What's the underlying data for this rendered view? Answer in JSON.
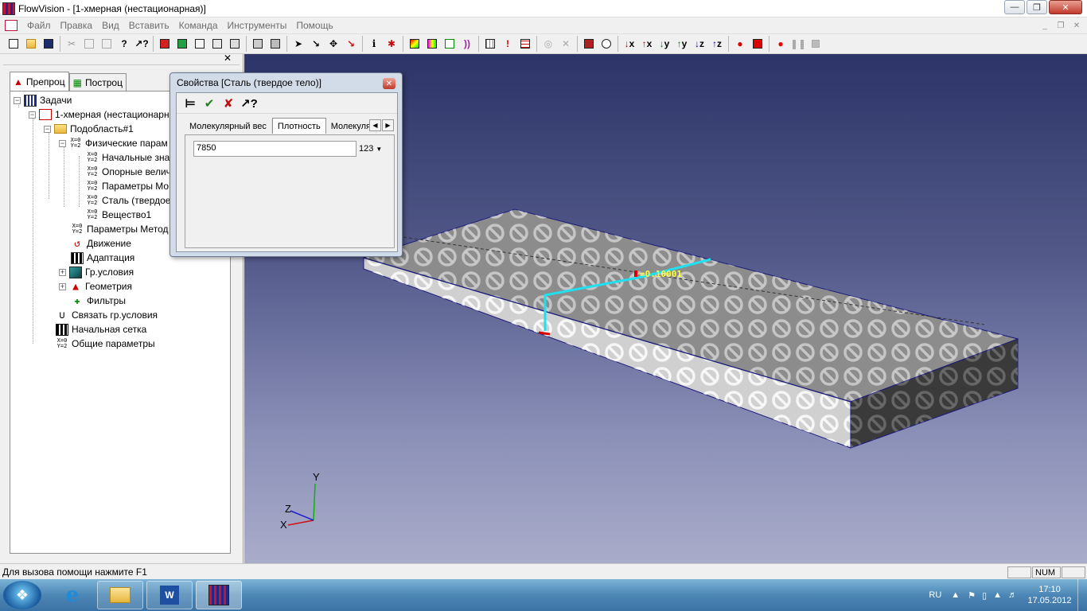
{
  "window": {
    "title": "FlowVision - [1-хмерная (нестационарная)]"
  },
  "menu": [
    "Файл",
    "Правка",
    "Вид",
    "Вставить",
    "Команда",
    "Инструменты",
    "Помощь"
  ],
  "left_panel": {
    "tabs": [
      "Препроц",
      "Построц"
    ],
    "tree": [
      {
        "label": "Задачи"
      },
      {
        "label": "1-хмерная (нестационарн"
      },
      {
        "label": "Подобласть#1"
      },
      {
        "label": "Физические парам"
      },
      {
        "label": "Начальные зна"
      },
      {
        "label": "Опорные велич"
      },
      {
        "label": "Параметры Мо"
      },
      {
        "label": "Сталь (твердое"
      },
      {
        "label": "Вещество1"
      },
      {
        "label": "Параметры Метод"
      },
      {
        "label": "Движение"
      },
      {
        "label": "Адаптация"
      },
      {
        "label": "Гр.условия"
      },
      {
        "label": "Геометрия"
      },
      {
        "label": "Фильтры"
      },
      {
        "label": "Связать гр.условия"
      },
      {
        "label": "Начальная сетка"
      },
      {
        "label": "Общие параметры"
      }
    ]
  },
  "dialog": {
    "title": "Свойства [Сталь (твердое тело)]",
    "tabs": [
      "Молекулярный вес",
      "Плотность",
      "Молекуля"
    ],
    "value": "7850",
    "unit": "123"
  },
  "viewport": {
    "axes": {
      "x": "X",
      "y": "Y",
      "z": "Z"
    },
    "probe_label": "=0.10001"
  },
  "status": {
    "help": "Для вызова помощи нажмите F1",
    "num": "NUM"
  },
  "taskbar": {
    "lang": "RU",
    "time": "17:10",
    "date": "17.05.2012"
  }
}
